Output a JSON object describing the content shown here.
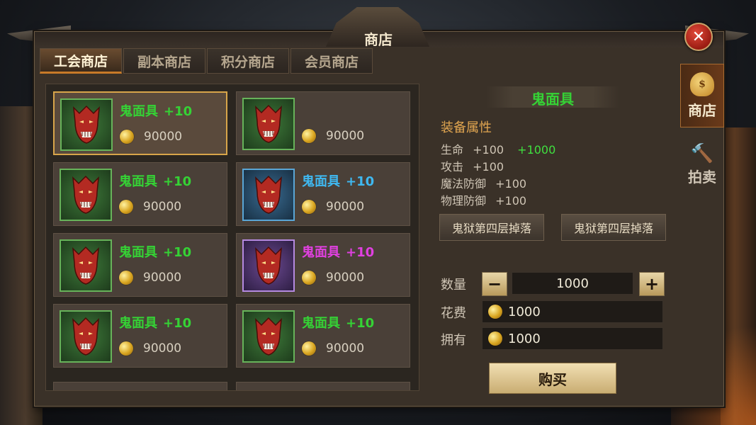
{
  "window": {
    "title": "商店",
    "close_glyph": "✕"
  },
  "tabs": [
    {
      "label": "工会商店",
      "active": true
    },
    {
      "label": "副本商店",
      "active": false
    },
    {
      "label": "积分商店",
      "active": false
    },
    {
      "label": "会员商店",
      "active": false
    }
  ],
  "items": [
    {
      "name": "鬼面具",
      "plus": "+10",
      "price": "90000",
      "name_color": "#35d235",
      "frame": "green",
      "selected": true
    },
    {
      "name": "",
      "plus": "",
      "price": "90000",
      "name_color": "#35d235",
      "frame": "green",
      "selected": false
    },
    {
      "name": "鬼面具",
      "plus": "+10",
      "price": "90000",
      "name_color": "#35d235",
      "frame": "green",
      "selected": false
    },
    {
      "name": "鬼面具",
      "plus": "+10",
      "price": "90000",
      "name_color": "#3fb8f0",
      "frame": "blue",
      "selected": false
    },
    {
      "name": "鬼面具",
      "plus": "+10",
      "price": "90000",
      "name_color": "#35d235",
      "frame": "green",
      "selected": false
    },
    {
      "name": "鬼面具",
      "plus": "+10",
      "price": "90000",
      "name_color": "#e040e0",
      "frame": "purple",
      "selected": false
    },
    {
      "name": "鬼面具",
      "plus": "+10",
      "price": "90000",
      "name_color": "#35d235",
      "frame": "green",
      "selected": false
    },
    {
      "name": "鬼面具",
      "plus": "+10",
      "price": "90000",
      "name_color": "#35d235",
      "frame": "green",
      "selected": false
    }
  ],
  "detail": {
    "title": "鬼面具",
    "section_title": "装备属性",
    "attributes": [
      {
        "name": "生命",
        "value": "+100",
        "bonus": "+1000"
      },
      {
        "name": "攻击",
        "value": "+100",
        "bonus": ""
      },
      {
        "name": "魔法防御",
        "value": "+100",
        "bonus": ""
      },
      {
        "name": "物理防御",
        "value": "+100",
        "bonus": ""
      }
    ],
    "sources": [
      "鬼狱第四层掉落",
      "鬼狱第四层掉落"
    ],
    "quantity_label": "数量",
    "minus": "−",
    "plus": "+",
    "quantity": "1000",
    "cost_label": "花费",
    "cost": "1000",
    "own_label": "拥有",
    "own": "1000",
    "buy_label": "购买"
  },
  "side_tabs": [
    {
      "label": "商店",
      "icon": "money-bag-icon",
      "glyph": "$",
      "active": true
    },
    {
      "label": "拍卖",
      "icon": "gavel-icon",
      "glyph": "🔨",
      "active": false
    }
  ],
  "colors": {
    "accent": "#c87a28",
    "quality_green": "#35d235",
    "quality_blue": "#3fb8f0",
    "quality_purple": "#e040e0"
  }
}
